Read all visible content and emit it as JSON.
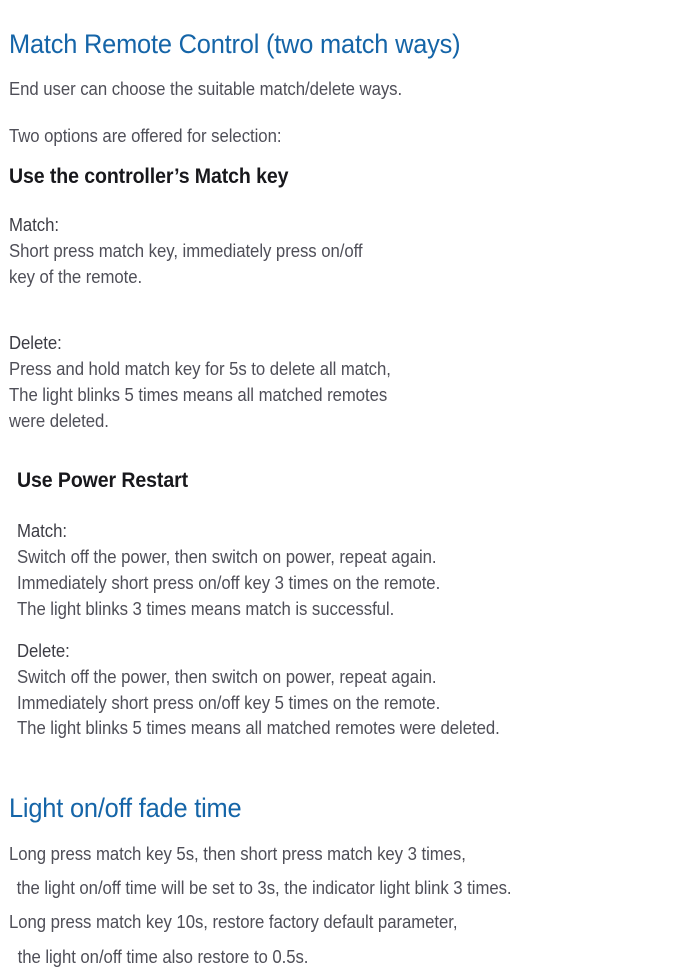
{
  "document": {
    "title": "Match Remote Control (two match ways)",
    "intro": [
      "End user can choose the suitable match/delete ways.",
      "Two options are offered for selection:"
    ],
    "colors": {
      "heading_blue": "#1565a8",
      "heading_dark": "#18181c",
      "body_text": "#4f4f58",
      "page_background": "#ffffff"
    },
    "sections": [
      {
        "heading": "Use the controller’s Match key",
        "match": {
          "label": "Match:",
          "lines": [
            "Short press match key, immediately press on/off",
            "key of the remote."
          ]
        },
        "delete": {
          "label": "Delete:",
          "lines": [
            "Press and hold match key for 5s to delete all match,",
            "The light blinks 5 times means all matched remotes",
            "were deleted."
          ]
        }
      },
      {
        "heading": "Use Power Restart",
        "match": {
          "label": "Match:",
          "lines": [
            "Switch off the power, then switch on power, repeat again.",
            "Immediately short press on/off key 3 times on the remote.",
            "The light blinks 3 times means match is successful."
          ]
        },
        "delete": {
          "label": "Delete:",
          "lines": [
            "Switch off the power, then switch on power, repeat again.",
            "Immediately short press on/off key 5 times on the remote.",
            "The light blinks 5 times means all matched remotes were deleted."
          ]
        }
      }
    ],
    "fade_time": {
      "heading": "Light on/off fade time",
      "lines": [
        "Long press match key 5s, then short press match key 3 times,",
        " the light on/off time will be set to 3s, the indicator light blink 3 times.",
        "Long press match key 10s, restore factory default parameter,",
        " the light on/off time also restore to 0.5s."
      ]
    }
  }
}
